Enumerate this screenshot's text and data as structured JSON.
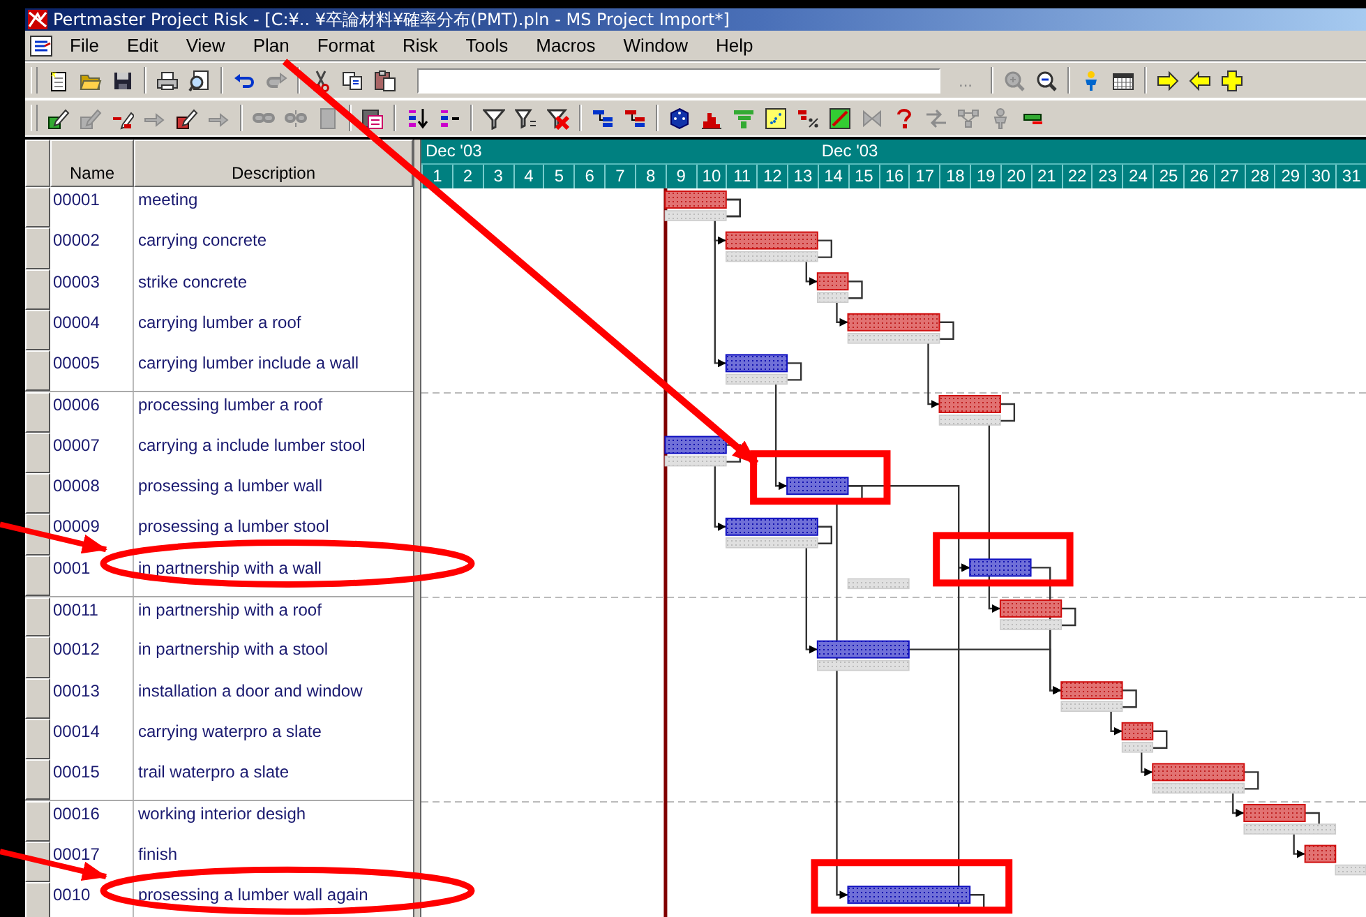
{
  "window": {
    "title": "Pertmaster Project Risk - [C:¥.. ¥卒論材料¥確率分布(PMT).pln - MS Project Import*]"
  },
  "menu": [
    "File",
    "Edit",
    "View",
    "Plan",
    "Format",
    "Risk",
    "Tools",
    "Macros",
    "Window",
    "Help"
  ],
  "toolbar_1": [
    {
      "kind": "new",
      "disabled": false
    },
    {
      "kind": "open",
      "disabled": false
    },
    {
      "kind": "save",
      "disabled": false
    },
    {
      "kind": "separator"
    },
    {
      "kind": "print",
      "disabled": false
    },
    {
      "kind": "preview",
      "disabled": false
    },
    {
      "kind": "separator"
    },
    {
      "kind": "undo",
      "disabled": false
    },
    {
      "kind": "redo",
      "disabled": true
    },
    {
      "kind": "separator"
    },
    {
      "kind": "cut",
      "disabled": false
    },
    {
      "kind": "copy",
      "disabled": false
    },
    {
      "kind": "paste",
      "disabled": false
    },
    {
      "kind": "field"
    },
    {
      "kind": "text-button",
      "label": "...",
      "disabled": true
    },
    {
      "kind": "separator"
    },
    {
      "kind": "zoom-in",
      "disabled": true
    },
    {
      "kind": "zoom-out",
      "disabled": false
    },
    {
      "kind": "separator"
    },
    {
      "kind": "person",
      "disabled": false
    },
    {
      "kind": "calendar",
      "disabled": false
    },
    {
      "kind": "separator"
    },
    {
      "kind": "arrow-right",
      "disabled": false
    },
    {
      "kind": "arrow-left",
      "disabled": false
    },
    {
      "kind": "plus",
      "disabled": false
    }
  ],
  "toolbar_2": [
    {
      "kind": "task-edit",
      "disabled": false
    },
    {
      "kind": "task-edit",
      "disabled": true
    },
    {
      "kind": "task-remove",
      "disabled": false
    },
    {
      "kind": "task-move",
      "disabled": true
    },
    {
      "kind": "task-red",
      "disabled": false
    },
    {
      "kind": "task-move",
      "disabled": true
    },
    {
      "kind": "separator"
    },
    {
      "kind": "link",
      "disabled": true
    },
    {
      "kind": "unlink",
      "disabled": true
    },
    {
      "kind": "block",
      "disabled": true
    },
    {
      "kind": "separator"
    },
    {
      "kind": "paste-special",
      "disabled": false
    },
    {
      "kind": "separator"
    },
    {
      "kind": "sort",
      "disabled": false
    },
    {
      "kind": "sort-options",
      "disabled": false
    },
    {
      "kind": "separator"
    },
    {
      "kind": "filter",
      "disabled": false
    },
    {
      "kind": "filter-options",
      "disabled": false
    },
    {
      "kind": "filter-clear",
      "disabled": false
    },
    {
      "kind": "separator"
    },
    {
      "kind": "gantt-blue",
      "disabled": false
    },
    {
      "kind": "gantt-red",
      "disabled": false
    },
    {
      "kind": "separator"
    },
    {
      "kind": "dice",
      "disabled": false
    },
    {
      "kind": "histogram",
      "disabled": false
    },
    {
      "kind": "tornado",
      "disabled": false
    },
    {
      "kind": "scatter",
      "disabled": false
    },
    {
      "kind": "percent",
      "disabled": false
    },
    {
      "kind": "scatter-green",
      "disabled": false
    },
    {
      "kind": "butterfly",
      "disabled": true
    },
    {
      "kind": "risk",
      "disabled": false
    },
    {
      "kind": "swap",
      "disabled": true
    },
    {
      "kind": "network",
      "disabled": true
    },
    {
      "kind": "person",
      "disabled": true
    },
    {
      "kind": "bar-flag",
      "disabled": false
    }
  ],
  "table": {
    "columns": [
      "Name",
      "Description"
    ],
    "rows": [
      {
        "name": "00001",
        "description": "meeting",
        "critical": true
      },
      {
        "name": "00002",
        "description": "carrying concrete",
        "critical": true
      },
      {
        "name": "00003",
        "description": "strike concrete",
        "critical": true
      },
      {
        "name": "00004",
        "description": "carrying lumber a roof",
        "critical": true
      },
      {
        "name": "00005",
        "description": "carrying lumber include a wall",
        "critical": false
      },
      {
        "name": "00006",
        "description": "processing lumber a roof",
        "critical": true
      },
      {
        "name": "00007",
        "description": "carrying a include lumber stool",
        "critical": false
      },
      {
        "name": "00008",
        "description": "prosessing a lumber wall",
        "critical": false
      },
      {
        "name": "00009",
        "description": "prosessing a lumber stool",
        "critical": false
      },
      {
        "name": "0001",
        "description": "in partnership with a wall",
        "critical": false
      },
      {
        "name": "00011",
        "description": "in partnership with a roof",
        "critical": true
      },
      {
        "name": "00012",
        "description": "in partnership with a stool",
        "critical": false
      },
      {
        "name": "00013",
        "description": "installation a door and window",
        "critical": true
      },
      {
        "name": "00014",
        "description": "carrying waterpro a slate",
        "critical": true
      },
      {
        "name": "00015",
        "description": "trail waterpro a slate",
        "critical": true
      },
      {
        "name": "00016",
        "description": "working interior desigh",
        "critical": true
      },
      {
        "name": "00017",
        "description": "finish",
        "critical": true
      },
      {
        "name": "0010",
        "description": "prosessing a lumber wall again",
        "critical": false
      }
    ]
  },
  "timeline": {
    "months": [
      "Dec '03",
      "Dec '03"
    ],
    "days": [
      "1",
      "2",
      "3",
      "4",
      "5",
      "6",
      "7",
      "8",
      "9",
      "10",
      "11",
      "12",
      "13",
      "14",
      "15",
      "16",
      "17",
      "18",
      "19",
      "20",
      "21",
      "22",
      "23",
      "24",
      "25",
      "26",
      "27",
      "28",
      "29",
      "30",
      "31"
    ]
  },
  "annotations": [
    {
      "kind": "top-arrow"
    },
    {
      "kind": "box"
    },
    {
      "kind": "ellipse"
    },
    {
      "kind": "side-arrow"
    },
    {
      "kind": "box"
    },
    {
      "kind": "ellipse"
    },
    {
      "kind": "side-arrow"
    },
    {
      "kind": "box"
    }
  ]
}
